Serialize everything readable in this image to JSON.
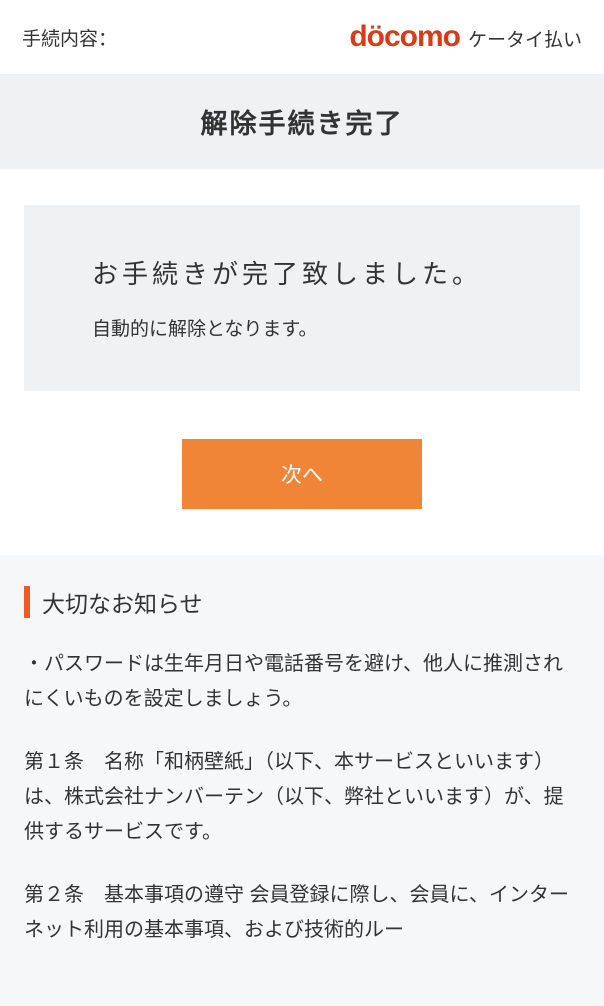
{
  "header": {
    "procedure_label": "手続内容：",
    "logo_text": "döcomo",
    "payment_text": "ケータイ払い"
  },
  "title": "解除手続き完了",
  "message": {
    "main": "お手続きが完了致しました。",
    "sub": "自動的に解除となります。"
  },
  "button": {
    "next": "次へ"
  },
  "notice": {
    "heading": "大切なお知らせ",
    "paragraphs": [
      "・パスワードは生年月日や電話番号を避け、他人に推測されにくいものを設定しましょう。",
      "第１条　名称「和柄壁紙」（以下、本サービスといいます）は、株式会社ナンバーテン（以下、弊社といいます）が、提供するサービスです。",
      "第２条　基本事項の遵守 会員登録に際し、会員に、インターネット利用の基本事項、および技術的ルー"
    ]
  }
}
